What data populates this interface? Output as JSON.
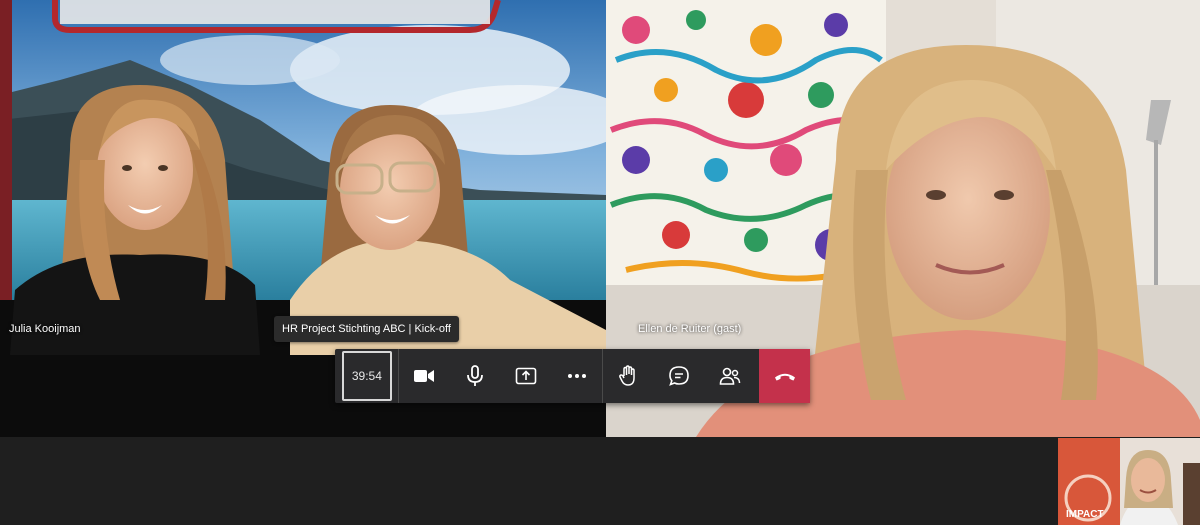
{
  "participants": [
    {
      "name": "Julia Kooijman"
    },
    {
      "name": "Ellen de Ruiter (gast)"
    }
  ],
  "meeting": {
    "title": "HR Project Stichting ABC | Kick-off",
    "timer": "39:54"
  },
  "controls": [
    {
      "icon": "camera-icon"
    },
    {
      "icon": "microphone-icon"
    },
    {
      "icon": "share-screen-icon"
    },
    {
      "icon": "more-options-icon"
    },
    {
      "icon": "raise-hand-icon"
    },
    {
      "icon": "chat-icon"
    },
    {
      "icon": "participants-icon"
    },
    {
      "icon": "hang-up-icon"
    }
  ],
  "colors": {
    "hangup": "#c4314b",
    "bar": "#2a2a2c",
    "background": "#1f1f1f"
  },
  "selfview": {
    "sign_text": "IMPACT"
  }
}
